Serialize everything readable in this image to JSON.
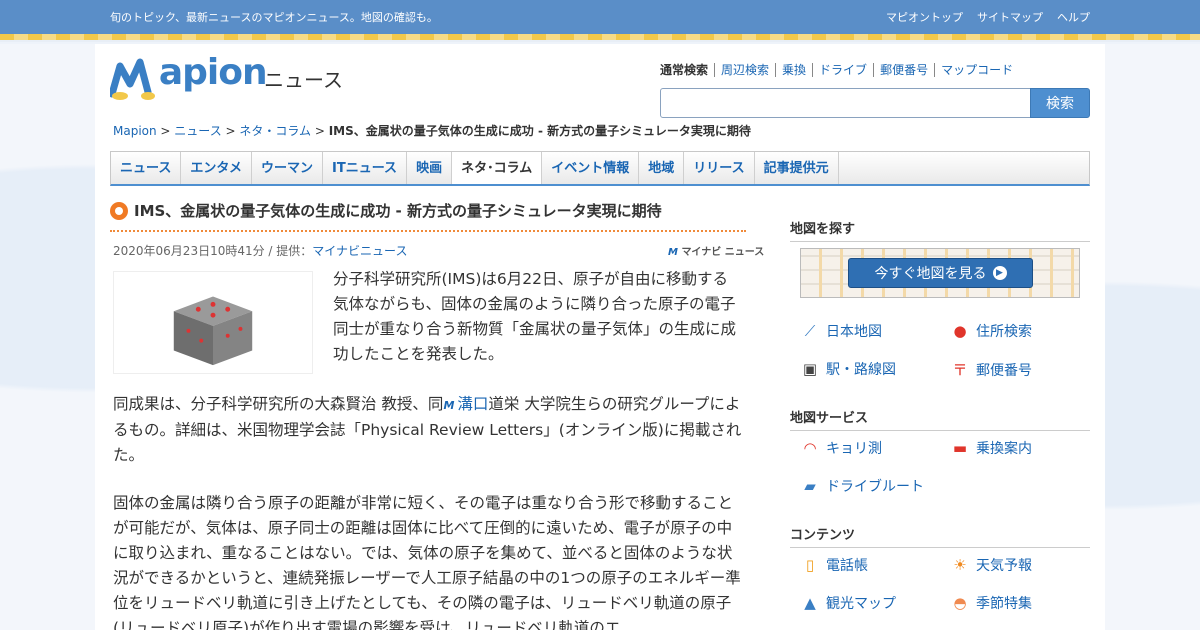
{
  "topbar": {
    "tagline": "旬のトピック、最新ニュースのマピオンニュース。地図の確認も。",
    "links": [
      "マピオントップ",
      "サイトマップ",
      "ヘルプ"
    ]
  },
  "header": {
    "logo_text": "Mapion",
    "section": "ニュース",
    "search_tabs": [
      "通常検索",
      "周辺検索",
      "乗換",
      "ドライブ",
      "郵便番号",
      "マップコード"
    ],
    "search_button": "検索",
    "search_value": ""
  },
  "breadcrumb": {
    "items": [
      "Mapion",
      "ニュース",
      "ネタ・コラム"
    ],
    "sep": " > ",
    "current": "IMS、金属状の量子気体の生成に成功 - 新方式の量子シミュレータ実現に期待"
  },
  "nav": [
    "ニュース",
    "エンタメ",
    "ウーマン",
    "ITニュース",
    "映画",
    "ネタ･コラム",
    "イベント情報",
    "地域",
    "リリース",
    "記事提供元"
  ],
  "nav_active": 5,
  "article": {
    "title": "IMS、金属状の量子気体の生成に成功 - 新方式の量子シミュレータ実現に期待",
    "date": "2020年06月23日10時41分 / 提供：",
    "provider": "マイナビニュース",
    "provider_logo": "マイナビ ニュース",
    "lead": "分子科学研究所(IMS)は6月22日、原子が自由に移動する気体ながらも、固体の金属のように隣り合った原子の電子同士が重なり合う新物質「金属状の量子気体」の生成に成功したことを発表した。",
    "p2_before": "同成果は、分子科学研究所の大森賢治 教授、同",
    "p2_kw": "溝口",
    "p2_after": "道栄 大学院生らの研究グループによるもの。詳細は、米国物理学会誌「Physical Review Letters」(オンライン版)に掲載された。",
    "p3": "固体の金属は隣り合う原子の距離が非常に短く、その電子は重なり合う形で移動することが可能だが、気体は、原子同士の距離は固体に比べて圧倒的に遠いため、電子が原子の中に取り込まれ、重なることはない。では、気体の原子を集めて、並べると固体のような状況ができるかというと、連続発振レーザーで人工原子結晶の中の1つの原子のエネルギー準位をリュードベリ軌道に引き上げたとしても、その隣の電子は、リュードベリ軌道の原子(リュードベリ原子)が作り出す電場の影響を受け、リュードベリ軌道のエ"
  },
  "sidebar": {
    "h_map": "地図を探す",
    "map_button": "今すぐ地図を見る",
    "map_links": [
      "日本地図",
      "住所検索",
      "駅・路線図",
      "郵便番号"
    ],
    "h_service": "地図サービス",
    "service_links": [
      "キョリ測",
      "乗換案内",
      "ドライブルート"
    ],
    "h_contents": "コンテンツ",
    "content_links": [
      "電話帳",
      "天気予報",
      "観光マップ",
      "季節特集"
    ]
  },
  "colors": {
    "accent": "#4e8fd0",
    "link": "#1a66b3",
    "title_bullet": "#f07a24"
  }
}
